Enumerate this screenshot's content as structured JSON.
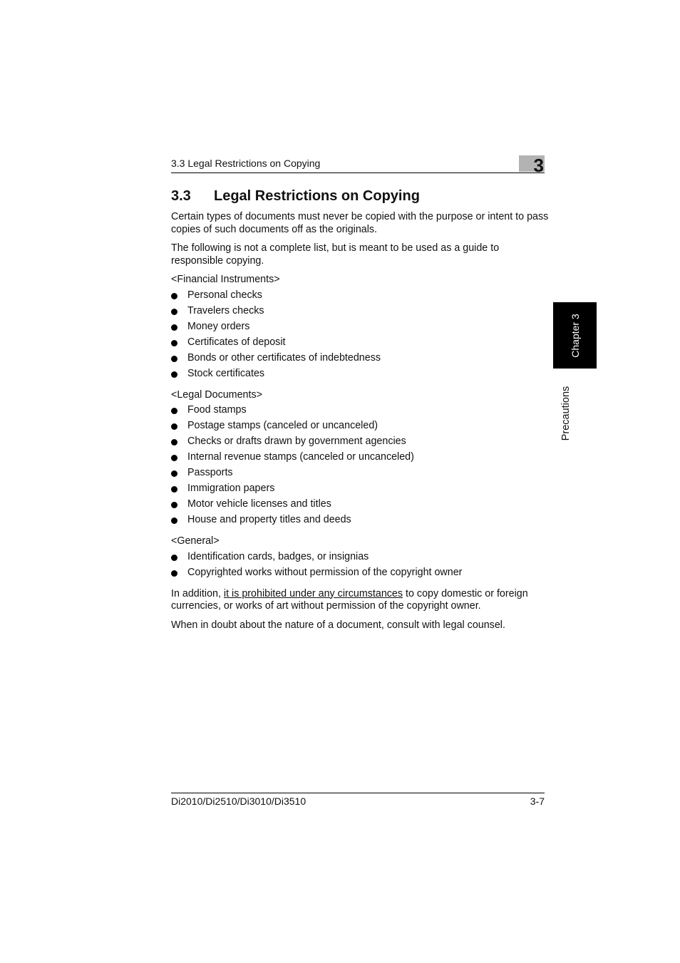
{
  "header": {
    "running_title": "3.3 Legal Restrictions on Copying",
    "chapter_number": "3"
  },
  "section": {
    "number": "3.3",
    "title": "Legal Restrictions on Copying"
  },
  "intro": [
    "Certain types of documents must never be copied with the purpose or intent to pass copies of such documents off as the originals.",
    "The following is not a complete list, but is meant to be used as a guide to responsible copying."
  ],
  "groups": [
    {
      "label": "<Financial Instruments>",
      "items": [
        "Personal checks",
        "Travelers checks",
        "Money orders",
        "Certificates of deposit",
        "Bonds or other certificates of indebtedness",
        "Stock certificates"
      ]
    },
    {
      "label": "<Legal Documents>",
      "items": [
        "Food stamps",
        "Postage stamps (canceled or uncanceled)",
        "Checks or drafts drawn by government agencies",
        "Internal revenue stamps (canceled or uncanceled)",
        "Passports",
        "Immigration papers",
        "Motor vehicle licenses and titles",
        "House and property titles and deeds"
      ]
    },
    {
      "label": "<General>",
      "items": [
        "Identification cards, badges, or insignias",
        "Copyrighted works without permission of the copyright owner"
      ]
    }
  ],
  "addition": {
    "prefix": "In addition, ",
    "underlined": "it is prohibited under any circumstances",
    "suffix": " to copy domestic or foreign currencies, or works of art without permission of the copyright owner."
  },
  "closing": "When in doubt about the nature of a document, consult with legal counsel.",
  "side": {
    "chapter_tab": "Chapter 3",
    "section_label": "Precautions"
  },
  "footer": {
    "model": "Di2010/Di2510/Di3010/Di3510",
    "page": "3-7"
  }
}
